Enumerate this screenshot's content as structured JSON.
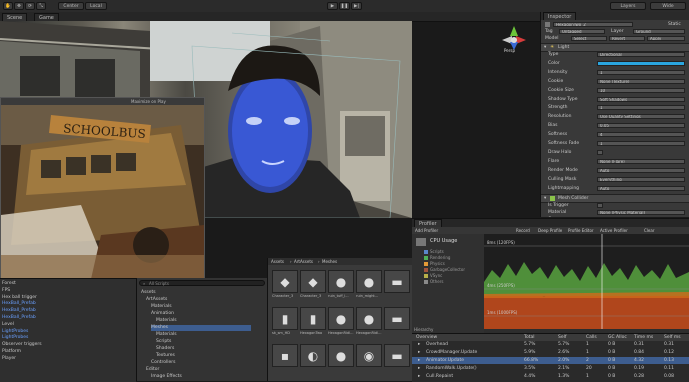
{
  "toolbar": {
    "pivot_label": "Center",
    "space_label": "Local",
    "layers_label": "Layers",
    "layout_label": "Wide"
  },
  "scene_tabs": [
    "Scene",
    "Game"
  ],
  "viewport": {
    "persp_label": "Persp"
  },
  "game_window": {
    "title": "Maximize on Play",
    "sign_text": "SCHOOLBUS"
  },
  "inspector": {
    "tab": "Inspector",
    "object_name": "HexagonTwo_2",
    "static_label": "Static",
    "tag_label": "Tag",
    "tag_value": "Untagged",
    "layer_label": "Layer",
    "layer_value": "Ground",
    "model_label": "Model",
    "model_buttons": [
      "Select",
      "Revert",
      "Apply"
    ],
    "component": "Light",
    "rows": [
      {
        "label": "Type",
        "value": "Directional"
      },
      {
        "label": "Color",
        "value": ""
      },
      {
        "label": "Intensity",
        "value": "1"
      },
      {
        "label": "Cookie",
        "value": "None (Texture)"
      },
      {
        "label": "Cookie Size",
        "value": "10"
      },
      {
        "label": "Shadow Type",
        "value": "Soft Shadows"
      },
      {
        "label": "Strength",
        "value": "1"
      },
      {
        "label": "Resolution",
        "value": "Use Quality Settings"
      },
      {
        "label": "Bias",
        "value": "0.05"
      },
      {
        "label": "Softness",
        "value": "4"
      },
      {
        "label": "Softness Fade",
        "value": "1"
      },
      {
        "label": "Draw Halo",
        "value": ""
      },
      {
        "label": "Flare",
        "value": "None (Flare)"
      },
      {
        "label": "Render Mode",
        "value": "Auto"
      },
      {
        "label": "Culling Mask",
        "value": "Everything"
      },
      {
        "label": "Lightmapping",
        "value": "Auto"
      }
    ],
    "component2": "Mesh Collider",
    "rows2": [
      {
        "label": "Is Trigger",
        "value": ""
      },
      {
        "label": "Material",
        "value": "None (Physic Material)"
      },
      {
        "label": "Convex",
        "value": ""
      }
    ]
  },
  "hierarchy": {
    "items": [
      "Forest",
      "FPS",
      "Hex ball trigger",
      "HexBall_Prefab",
      "HexBall_Prefab",
      "HexBall_Prefab",
      "Level",
      "LightProbes",
      "LightProbes",
      "Observer triggers",
      "Platform",
      "Player"
    ]
  },
  "project": {
    "search_placeholder": "All Scripts",
    "items": [
      "Assets",
      "ArtAssets",
      "Materials",
      "Animation",
      "Materials",
      "Meshes",
      "Materials",
      "Scripts",
      "Shaders",
      "Textures",
      "Controllers",
      "Editor",
      "Image Effects"
    ]
  },
  "assets": {
    "breadcrumb": [
      "Assets",
      "ArtAssets",
      "Meshes"
    ],
    "items": [
      "Character_3",
      "Character_3",
      "ruin_tuff_l...",
      "ruin_might...",
      "",
      "sk_sm_HD",
      "HexagonTwo",
      "HexagonRidl...",
      "HexagonRidl...",
      "",
      "",
      "",
      "",
      "",
      ""
    ]
  },
  "profiler": {
    "tab": "Profiler",
    "add_profiler": "Add Profiler",
    "buttons": [
      "Record",
      "Deep Profile",
      "Profile Editor",
      "Active Profiler",
      "Clear"
    ],
    "cpu_title": "CPU Usage",
    "legend": [
      "Scripts",
      "Rendering",
      "Physics",
      "GarbageCollector",
      "VSync",
      "Others"
    ],
    "legend_colors": [
      "#5b87c9",
      "#4fb157",
      "#e39a37",
      "#a1533c",
      "#b8b04a",
      "#8a8a8a"
    ],
    "marks": [
      "8ms (120FPS)",
      "4ms (250FPS)",
      "1ms (1000FPS)"
    ]
  },
  "overview": {
    "title_hierarchy": "Hierarchy",
    "columns": [
      "Overview",
      "Total",
      "Self",
      "Calls",
      "GC Alloc",
      "Time ms",
      "Self ms"
    ],
    "rows": [
      [
        "Overhead",
        "5.7%",
        "5.7%",
        "1",
        "0 B",
        "0.31",
        "0.31"
      ],
      [
        "CrowdManager.Update",
        "5.9%",
        "2.6%",
        "1",
        "0 B",
        "0.84",
        "0.12"
      ],
      [
        "Animator.Update",
        "66.8%",
        "2.0%",
        "2",
        "0 B",
        "4.32",
        "0.13"
      ],
      [
        "RandomWalk.Update()",
        "3.5%",
        "2.1%",
        "20",
        "0 B",
        "0.19",
        "0.11"
      ],
      [
        "Cull.Repaint",
        "4.4%",
        "1.3%",
        "1",
        "0 B",
        "0.28",
        "0.08"
      ]
    ]
  }
}
